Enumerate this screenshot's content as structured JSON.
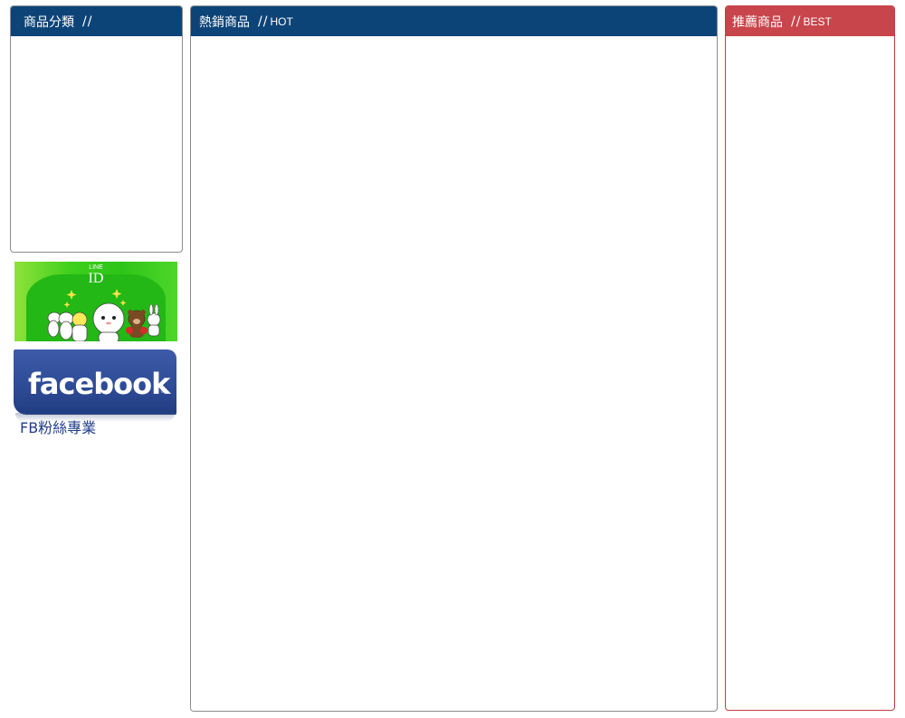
{
  "categories": {
    "title": "商品分類",
    "sep": "//",
    "subtitle": ""
  },
  "hot": {
    "title": "熱銷商品",
    "sep": "//",
    "subtitle": "HOT"
  },
  "best": {
    "title": "推薦商品",
    "sep": "//",
    "subtitle": "BEST"
  },
  "line_banner": {
    "brand": "LINE",
    "label": "ID"
  },
  "facebook_banner": {
    "brand": "facebook",
    "registered": "®",
    "caption": "FB粉絲專業"
  },
  "colors": {
    "panel_blue": "#0d4478",
    "panel_red": "#c8454b",
    "line_green": "#2cc418",
    "facebook_blue": "#2d4a95"
  }
}
